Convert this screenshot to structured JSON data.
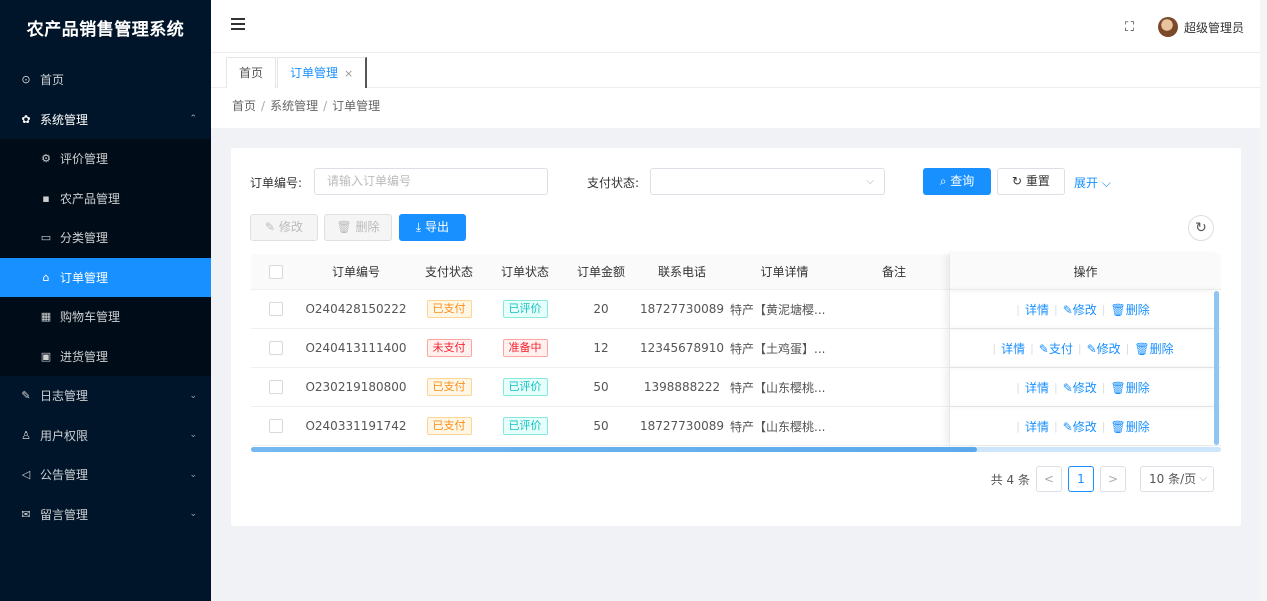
{
  "app": {
    "title": "农产品销售管理系统"
  },
  "sidebar": {
    "items": [
      {
        "label": "首页",
        "icon": "dashboard-icon"
      },
      {
        "label": "系统管理",
        "icon": "gear-icon",
        "arrow": "⌃"
      },
      {
        "label": "评价管理",
        "icon": "settings-icon"
      },
      {
        "label": "农产品管理",
        "icon": "chart-icon"
      },
      {
        "label": "分类管理",
        "icon": "category-icon"
      },
      {
        "label": "订单管理",
        "icon": "lock-icon"
      },
      {
        "label": "购物车管理",
        "icon": "grid-icon"
      },
      {
        "label": "进货管理",
        "icon": "box-icon"
      },
      {
        "label": "日志管理",
        "icon": "edit-icon",
        "arrow": "⌄"
      },
      {
        "label": "用户权限",
        "icon": "user-icon",
        "arrow": "⌄"
      },
      {
        "label": "公告管理",
        "icon": "megaphone-icon",
        "arrow": "⌄"
      },
      {
        "label": "留言管理",
        "icon": "mail-icon",
        "arrow": "⌄"
      }
    ]
  },
  "header": {
    "user": "超级管理员"
  },
  "tabs": [
    {
      "label": "首页"
    },
    {
      "label": "订单管理",
      "close": "×"
    }
  ],
  "breadcrumb": [
    "首页",
    "系统管理",
    "订单管理"
  ],
  "breadcrumb_sep": "/",
  "search": {
    "order_no_label": "订单编号:",
    "order_no_placeholder": "请输入订单编号",
    "pay_status_label": "支付状态:",
    "pay_status_value": "",
    "query_label": "查询",
    "reset_label": "重置",
    "expand_label": "展开"
  },
  "toolbar": {
    "edit_label": "修改",
    "delete_label": "删除",
    "export_label": "导出"
  },
  "table": {
    "headers": [
      "订单编号",
      "支付状态",
      "订单状态",
      "订单金额",
      "联系电话",
      "订单详情",
      "备注",
      "操作"
    ],
    "rows": [
      {
        "no": "O240428150222",
        "pay": "已支付",
        "status": "已评价",
        "amount": "20",
        "tel": "18727730089",
        "detail": "特产【黄泥塘樱...",
        "note": "",
        "ops": [
          "详情",
          "修改",
          "删除"
        ]
      },
      {
        "no": "O240413111400",
        "pay": "未支付",
        "status": "准备中",
        "amount": "12",
        "tel": "12345678910",
        "detail": "特产【土鸡蛋】...",
        "note": "",
        "ops": [
          "详情",
          "支付",
          "修改",
          "删除"
        ]
      },
      {
        "no": "O230219180800",
        "pay": "已支付",
        "status": "已评价",
        "amount": "50",
        "tel": "1398888222",
        "detail": "特产【山东樱桃...",
        "note": "",
        "ops": [
          "详情",
          "修改",
          "删除"
        ]
      },
      {
        "no": "O240331191742",
        "pay": "已支付",
        "status": "已评价",
        "amount": "50",
        "tel": "18727730089",
        "detail": "特产【山东樱桃...",
        "note": "",
        "ops": [
          "详情",
          "修改",
          "删除"
        ]
      }
    ]
  },
  "pagination": {
    "total": "共 4 条",
    "current": "1",
    "prev": "<",
    "next": ">",
    "page_size": "10 条/页"
  },
  "colors": {
    "primary": "#1890ff",
    "sidebar_bg": "#001529",
    "submenu_bg": "#000c17"
  }
}
